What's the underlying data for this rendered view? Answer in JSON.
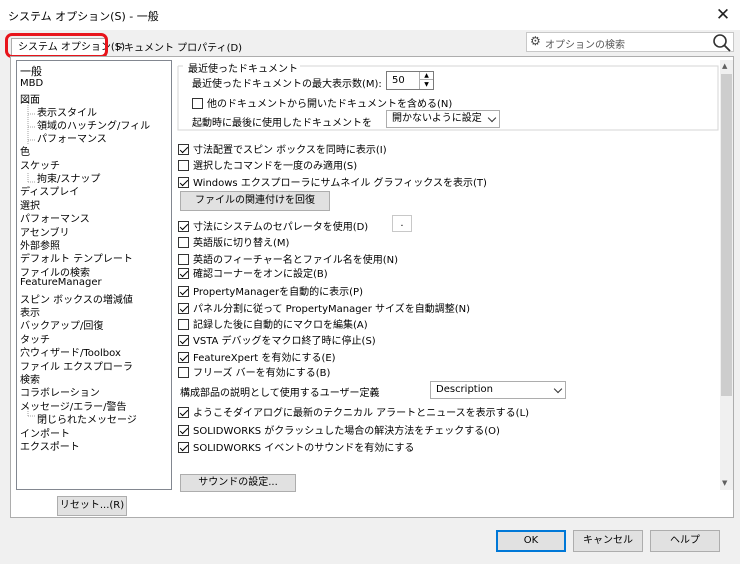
{
  "window": {
    "title": "システム オプション(S) - 一般",
    "close": "✕"
  },
  "tabs": [
    {
      "label": "システム オプション(S)"
    },
    {
      "label": "ドキュメント プロパティ(D)"
    }
  ],
  "search": {
    "placeholder": "オプションの検索",
    "gear": "⚙"
  },
  "tree": {
    "items": [
      "一般",
      "MBD",
      "図面",
      "表示スタイル",
      "領域のハッチング/フィル",
      "パフォーマンス",
      "色",
      "スケッチ",
      "拘束/スナップ",
      "ディスプレイ",
      "選択",
      "パフォーマンス",
      "アセンブリ",
      "外部参照",
      "デフォルト テンプレート",
      "ファイルの検索",
      "FeatureManager",
      "スピン ボックスの増減値",
      "表示",
      "バックアップ/回復",
      "タッチ",
      "穴ウィザード/Toolbox",
      "ファイル エクスプローラ",
      "検索",
      "コラボレーション",
      "メッセージ/エラー/警告",
      "閉じられたメッセージ",
      "インポート",
      "エクスポート"
    ]
  },
  "reset_label": "リセット...(R)",
  "recent": {
    "group_title": "最近使ったドキュメント",
    "max_label": "最近使ったドキュメントの最大表示数(M):",
    "max_value": "50",
    "include_label": "他のドキュメントから開いたドキュメントを含める(N)",
    "startup_label": "起動時に最後に使用したドキュメントを",
    "startup_value": "開かないように設定"
  },
  "options": {
    "o1": "寸法配置でスピン ボックスを同時に表示(I)",
    "o2": "選択したコマンドを一度のみ適用(S)",
    "o3": "Windows エクスプローラにサムネイル グラフィックスを表示(T)",
    "file_assoc": "ファイルの関連付けを回復",
    "o4": "寸法にシステムのセパレータを使用(D)",
    "separator": ".",
    "o5": "英語版に切り替え(M)",
    "o6": "英語のフィーチャー名とファイル名を使用(N)",
    "o7": "確認コーナーをオンに設定(B)",
    "o8": "PropertyManagerを自動的に表示(P)",
    "o9": "パネル分割に従って PropertyManager サイズを自動調整(N)",
    "o10": "記録した後に自動的にマクロを編集(A)",
    "o11": "VSTA デバッグをマクロ終了時に停止(S)",
    "o12": "FeatureXpert を有効にする(E)",
    "o13": "フリーズ バーを有効にする(B)",
    "desc_label": "構成部品の説明として使用するユーザー定義",
    "desc_value": "Description",
    "o14": "ようこそダイアログに最新のテクニカル アラートとニュースを表示する(L)",
    "o15": "SOLIDWORKS がクラッシュした場合の解決方法をチェックする(O)",
    "o16": "SOLIDWORKS イベントのサウンドを有効にする",
    "sound_btn": "サウンドの設定..."
  },
  "buttons": {
    "ok": "OK",
    "cancel": "キャンセル",
    "help": "ヘルプ"
  }
}
